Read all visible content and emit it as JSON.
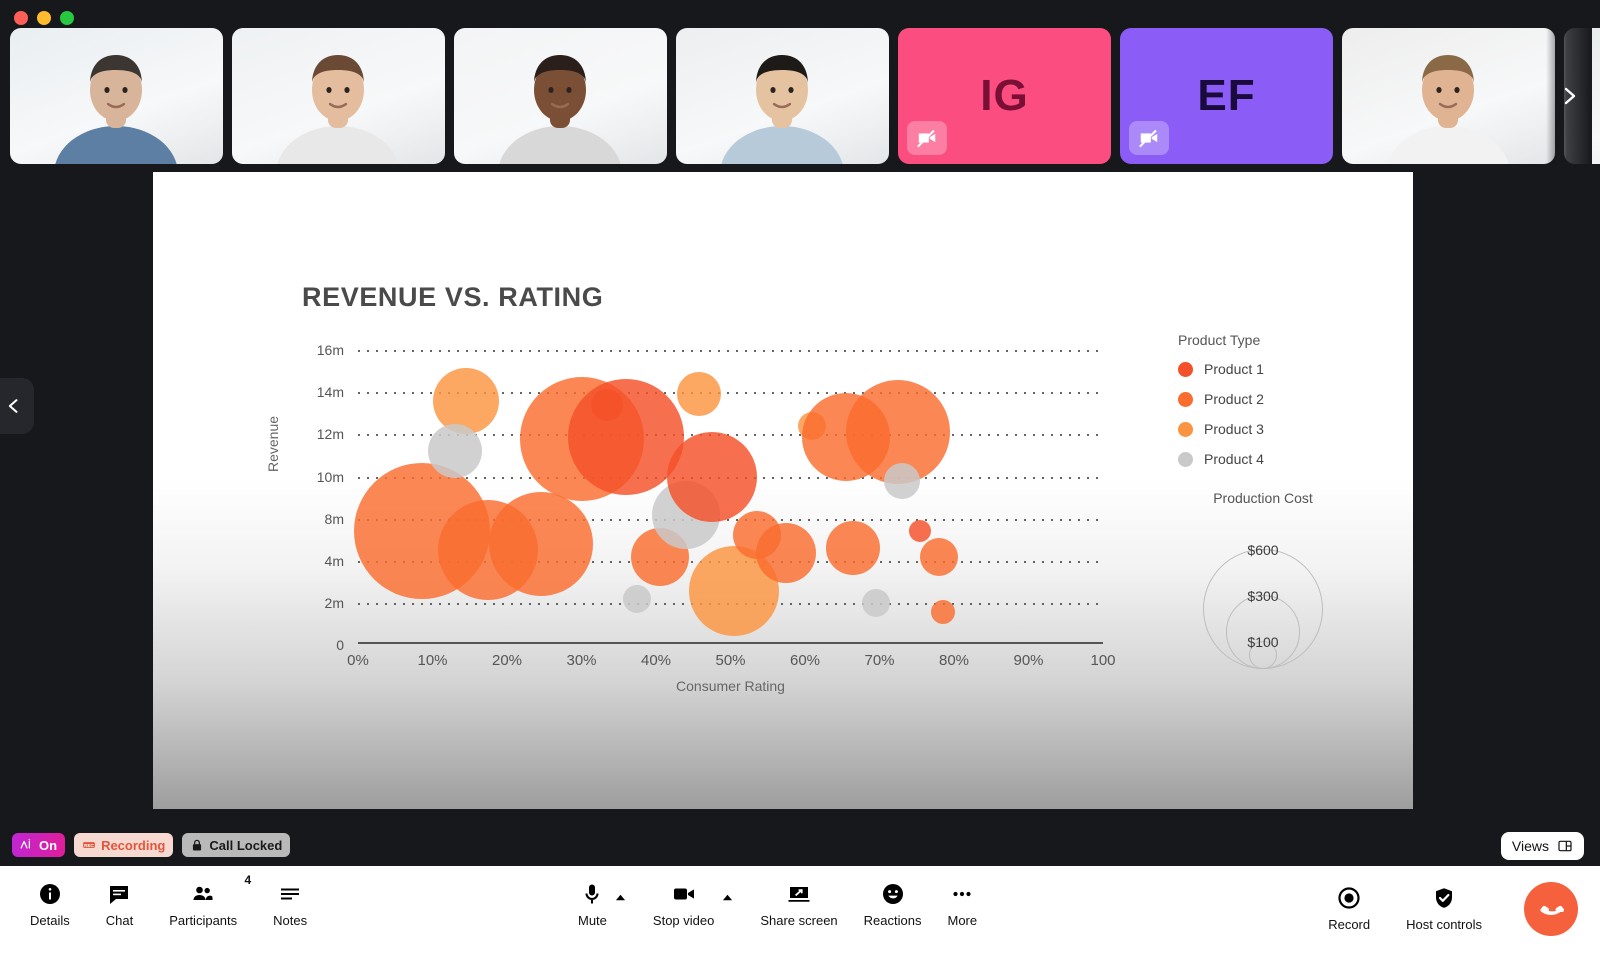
{
  "window": {
    "traffic_lights": [
      "close",
      "minimize",
      "maximize"
    ]
  },
  "filmstrip": {
    "next_icon": "chevron-right-icon",
    "tiles": [
      {
        "type": "video",
        "name": "participant-1",
        "muted_video": false
      },
      {
        "type": "video",
        "name": "participant-2",
        "muted_video": false
      },
      {
        "type": "video",
        "name": "participant-3",
        "muted_video": false
      },
      {
        "type": "video",
        "name": "participant-4",
        "muted_video": false
      },
      {
        "type": "initials",
        "name": "participant-5",
        "initials": "IG",
        "bg": "#fb4d7f",
        "fg": "#7a0f35",
        "muted_video": true
      },
      {
        "type": "initials",
        "name": "participant-6",
        "initials": "EF",
        "bg": "#8b5cf6",
        "fg": "#190b3c",
        "muted_video": true
      },
      {
        "type": "video",
        "name": "participant-7",
        "muted_video": false
      },
      {
        "type": "video",
        "name": "participant-8",
        "muted_video": false
      }
    ]
  },
  "page_prev_icon": "chevron-left-icon",
  "slide": {
    "title": "REVENUE VS. RATING",
    "legend_title": "Product Type",
    "size_legend_title": "Production Cost",
    "size_legend_labels": [
      "$600",
      "$300",
      "$100"
    ]
  },
  "chart_data": {
    "type": "scatter",
    "title": "REVENUE VS. RATING",
    "xlabel": "Consumer Rating",
    "ylabel": "Revenue",
    "xlim": [
      0,
      100
    ],
    "ylim": [
      0,
      16
    ],
    "grid": true,
    "legend_position": "right",
    "xticks": [
      "0%",
      "10%",
      "20%",
      "30%",
      "40%",
      "50%",
      "60%",
      "70%",
      "80%",
      "90%",
      "100"
    ],
    "xtick_values": [
      0,
      10,
      20,
      30,
      40,
      50,
      60,
      70,
      80,
      90,
      100
    ],
    "yticks": [
      "16m",
      "14m",
      "12m",
      "10m",
      "8m",
      "4m",
      "2m",
      "0"
    ],
    "ytick_values": [
      16,
      14,
      12,
      10,
      8,
      4,
      2,
      0
    ],
    "series": [
      {
        "name": "Product 1",
        "color": "#f4502a"
      },
      {
        "name": "Product 2",
        "color": "#fa6d2e"
      },
      {
        "name": "Product 3",
        "color": "#fb9440"
      },
      {
        "name": "Product 4",
        "color": "#c9c9c9"
      }
    ],
    "size_legend": {
      "label": "Production Cost",
      "values": [
        600,
        300,
        100
      ],
      "unit": "$"
    },
    "points": [
      {
        "x": 8.6,
        "y": 6.8,
        "r": 68,
        "series": "Product 2",
        "cost": 600
      },
      {
        "x": 14.5,
        "y": 13.6,
        "r": 33,
        "series": "Product 3",
        "cost": 210
      },
      {
        "x": 13.0,
        "y": 11.2,
        "r": 27,
        "series": "Product 4",
        "cost": 160
      },
      {
        "x": 17.5,
        "y": 5.0,
        "r": 50,
        "series": "Product 2",
        "cost": 380
      },
      {
        "x": 24.5,
        "y": 5.6,
        "r": 52,
        "series": "Product 2",
        "cost": 400
      },
      {
        "x": 30.0,
        "y": 11.8,
        "r": 62,
        "series": "Product 2",
        "cost": 520
      },
      {
        "x": 33.4,
        "y": 13.4,
        "r": 16,
        "series": "Product 1",
        "cost": 70
      },
      {
        "x": 36.0,
        "y": 11.9,
        "r": 58,
        "series": "Product 1",
        "cost": 470
      },
      {
        "x": 37.5,
        "y": 2.2,
        "r": 14,
        "series": "Product 4",
        "cost": 55
      },
      {
        "x": 40.5,
        "y": 4.4,
        "r": 29,
        "series": "Product 2",
        "cost": 180
      },
      {
        "x": 44.0,
        "y": 8.2,
        "r": 34,
        "series": "Product 4",
        "cost": 220
      },
      {
        "x": 45.8,
        "y": 13.9,
        "r": 22,
        "series": "Product 3",
        "cost": 110
      },
      {
        "x": 47.5,
        "y": 10.0,
        "r": 45,
        "series": "Product 1",
        "cost": 320
      },
      {
        "x": 50.5,
        "y": 2.6,
        "r": 45,
        "series": "Product 3",
        "cost": 320
      },
      {
        "x": 53.5,
        "y": 6.5,
        "r": 24,
        "series": "Product 2",
        "cost": 130
      },
      {
        "x": 57.5,
        "y": 4.8,
        "r": 30,
        "series": "Product 2",
        "cost": 190
      },
      {
        "x": 61.0,
        "y": 12.4,
        "r": 14,
        "series": "Product 3",
        "cost": 55
      },
      {
        "x": 65.5,
        "y": 11.9,
        "r": 44,
        "series": "Product 2",
        "cost": 310
      },
      {
        "x": 66.5,
        "y": 5.2,
        "r": 27,
        "series": "Product 2",
        "cost": 160
      },
      {
        "x": 69.5,
        "y": 2.0,
        "r": 14,
        "series": "Product 4",
        "cost": 55
      },
      {
        "x": 72.5,
        "y": 12.1,
        "r": 52,
        "series": "Product 2",
        "cost": 400
      },
      {
        "x": 73.0,
        "y": 9.8,
        "r": 18,
        "series": "Product 4",
        "cost": 80
      },
      {
        "x": 75.5,
        "y": 6.8,
        "r": 11,
        "series": "Product 1",
        "cost": 35
      },
      {
        "x": 78.0,
        "y": 4.4,
        "r": 19,
        "series": "Product 2",
        "cost": 90
      },
      {
        "x": 78.5,
        "y": 1.6,
        "r": 12,
        "series": "Product 2",
        "cost": 40
      }
    ]
  },
  "status_badges": [
    {
      "id": "ai-on",
      "icon": "ai-wave-icon",
      "label": "On",
      "style": "ai"
    },
    {
      "id": "recording",
      "icon": "rec-icon",
      "label": "Recording",
      "style": "rec"
    },
    {
      "id": "call-locked",
      "icon": "lock-icon",
      "label": "Call Locked",
      "style": "lock"
    }
  ],
  "views_button": {
    "label": "Views",
    "icon": "layout-grid-icon"
  },
  "toolbar": {
    "left": [
      {
        "id": "details",
        "label": "Details",
        "icon": "info-icon"
      },
      {
        "id": "chat",
        "label": "Chat",
        "icon": "chat-icon"
      },
      {
        "id": "participants",
        "label": "Participants",
        "icon": "people-icon",
        "badge": "4"
      },
      {
        "id": "notes",
        "label": "Notes",
        "icon": "notes-icon"
      }
    ],
    "middle": [
      {
        "id": "mute",
        "label": "Mute",
        "icon": "microphone-icon",
        "caret": true
      },
      {
        "id": "stop-video",
        "label": "Stop video",
        "icon": "video-camera-icon",
        "caret": true
      },
      {
        "id": "share-screen",
        "label": "Share screen",
        "icon": "screen-share-icon"
      },
      {
        "id": "reactions",
        "label": "Reactions",
        "icon": "smiley-icon"
      },
      {
        "id": "more",
        "label": "More",
        "icon": "ellipsis-icon"
      }
    ],
    "right": [
      {
        "id": "record",
        "label": "Record",
        "icon": "record-icon"
      },
      {
        "id": "host-controls",
        "label": "Host controls",
        "icon": "shield-check-icon"
      }
    ],
    "hangup": {
      "id": "leave-call",
      "icon": "hangup-icon",
      "color": "#f4613c"
    }
  }
}
